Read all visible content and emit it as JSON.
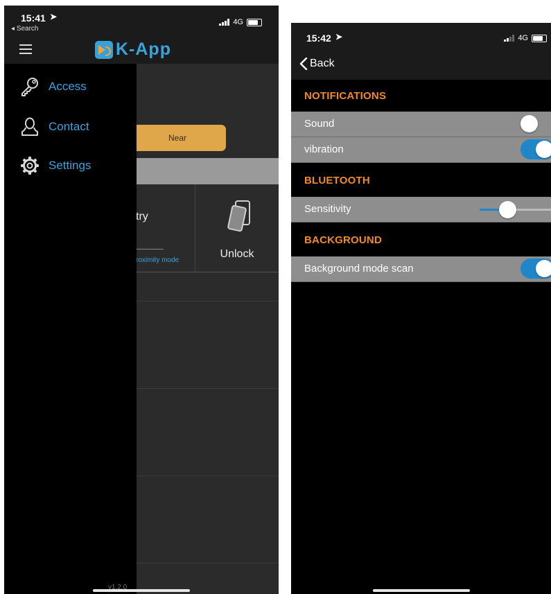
{
  "left_screen": {
    "status": {
      "time": "15:41",
      "back_label": "Search",
      "network": "4G"
    },
    "app_title": "K-App",
    "mode_button": "Near",
    "entry_tile": {
      "title": "try",
      "subtitle": "roximity mode"
    },
    "unlock_tile": {
      "label": "Unlock"
    },
    "drawer": {
      "items": [
        {
          "label": "Access",
          "icon": "key-icon"
        },
        {
          "label": "Contact",
          "icon": "person-icon"
        },
        {
          "label": "Settings",
          "icon": "gear-icon"
        }
      ],
      "version": "v1.2.0"
    }
  },
  "right_screen": {
    "status": {
      "time": "15:42",
      "network": "4G"
    },
    "back_label": "Back",
    "sections": {
      "notifications": {
        "title": "NOTIFICATIONS",
        "sound": {
          "label": "Sound",
          "enabled": false
        },
        "vibration": {
          "label": "vibration",
          "enabled": true
        }
      },
      "bluetooth": {
        "title": "BLUETOOTH",
        "sensitivity": {
          "label": "Sensitivity",
          "level": 0.39
        }
      },
      "background": {
        "title": "BACKGROUND",
        "scan": {
          "label": "Background mode scan",
          "enabled": true
        }
      }
    }
  },
  "colors": {
    "accent_blue": "#3aa3dc",
    "toggle_on": "#1f87c7",
    "section_orange": "#f08a2a",
    "near_pill": "#e0a64a"
  }
}
